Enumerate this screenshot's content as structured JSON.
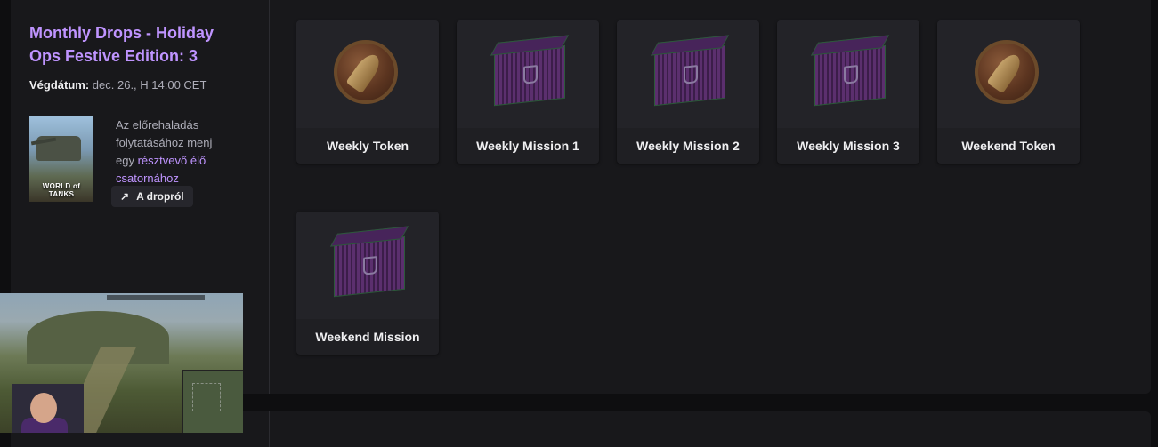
{
  "campaign": {
    "title": "Monthly Drops - Holiday Ops Festive Edition: 3",
    "end_label": "Végdátum:",
    "end_value": "dec. 26., H 14:00 CET",
    "game_logo_text": "WORLD of TANKS",
    "info_text_before": "Az előrehaladás folytatásához menj egy",
    "info_link": "résztvevő élő csatornához",
    "about_button": "A dropról",
    "about_icon": "arrow-up-right-icon"
  },
  "rewards": [
    {
      "label": "Weekly Token",
      "icon": "token-icon"
    },
    {
      "label": "Weekly Mission 1",
      "icon": "crate-icon"
    },
    {
      "label": "Weekly Mission 2",
      "icon": "crate-icon"
    },
    {
      "label": "Weekly Mission 3",
      "icon": "crate-icon"
    },
    {
      "label": "Weekend Token",
      "icon": "token-icon"
    },
    {
      "label": "Weekend Mission",
      "icon": "crate-icon"
    }
  ],
  "colors": {
    "accent": "#bf94ff",
    "card_bg": "#18181b",
    "page_bg": "#0e0e10"
  }
}
